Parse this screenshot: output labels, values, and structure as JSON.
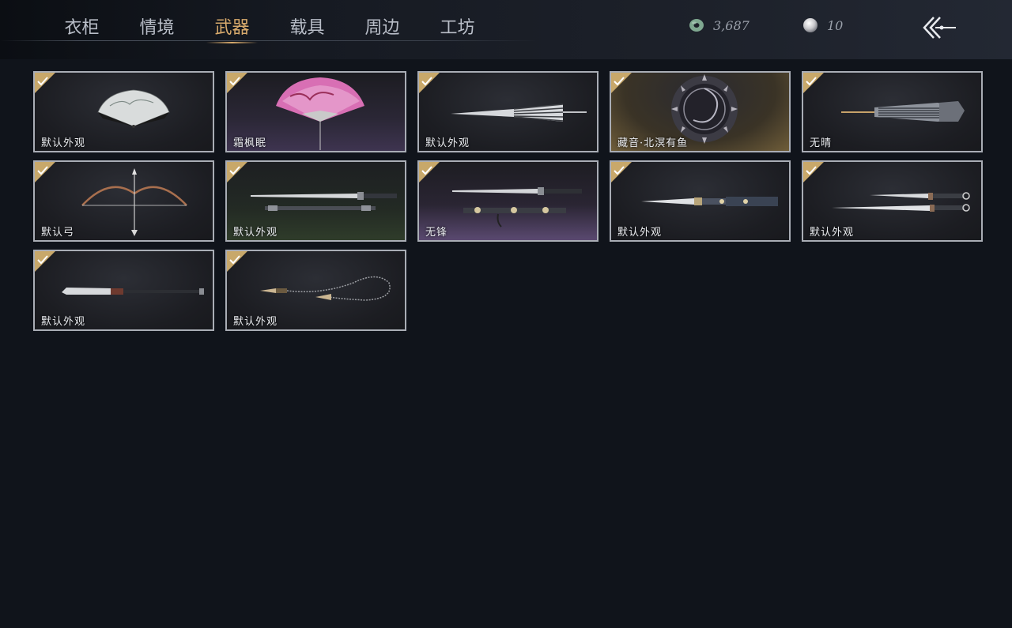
{
  "tabs": [
    {
      "label": "衣柜"
    },
    {
      "label": "情境"
    },
    {
      "label": "武器",
      "active": true
    },
    {
      "label": "载具"
    },
    {
      "label": "周边"
    },
    {
      "label": "工坊"
    }
  ],
  "currency": {
    "jade": {
      "value": "3,687",
      "icon": "jade-coin-icon"
    },
    "pearl": {
      "value": "10",
      "icon": "pearl-icon"
    }
  },
  "back": {
    "icon": "back-arrow-icon"
  },
  "weapons": [
    {
      "label": "默认外观",
      "icon": "folding-fan-icon",
      "owned": true
    },
    {
      "label": "霜枫眠",
      "icon": "pink-fan-icon",
      "owned": true
    },
    {
      "label": "默认外观",
      "icon": "umbrella-icon",
      "owned": true
    },
    {
      "label": "藏音·北溟有鱼",
      "icon": "shield-icon",
      "owned": true
    },
    {
      "label": "无晴",
      "icon": "closed-umbrella-icon",
      "owned": true
    },
    {
      "label": "默认弓",
      "icon": "bow-icon",
      "owned": true
    },
    {
      "label": "默认外观",
      "icon": "sword-icon",
      "owned": true
    },
    {
      "label": "无锋",
      "icon": "sword-icon",
      "owned": true
    },
    {
      "label": "默认外观",
      "icon": "sword-icon",
      "owned": true
    },
    {
      "label": "默认外观",
      "icon": "dual-blades-icon",
      "owned": true
    },
    {
      "label": "默认外观",
      "icon": "glaive-icon",
      "owned": true
    },
    {
      "label": "默认外观",
      "icon": "rope-dart-icon",
      "owned": true
    }
  ]
}
